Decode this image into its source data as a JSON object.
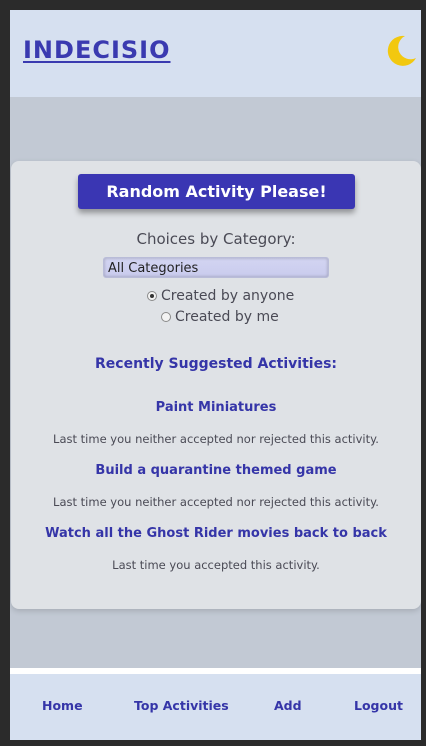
{
  "header": {
    "logo": "INDECISIO",
    "theme_toggle_icon": "moon-icon",
    "moon_color": "#f2c80f"
  },
  "main": {
    "random_button_label": "Random Activity Please!",
    "choices_label": "Choices by Category:",
    "category_selected": "All Categories",
    "filter_options": [
      {
        "label": "Created by anyone",
        "checked": true
      },
      {
        "label": "Created by me",
        "checked": false
      }
    ],
    "recent_heading": "Recently Suggested Activities:",
    "activities": [
      {
        "title": "Paint Miniatures",
        "status": "Last time you neither accepted nor rejected this activity."
      },
      {
        "title": "Build a quarantine themed game",
        "status": "Last time you neither accepted nor rejected this activity."
      },
      {
        "title": "Watch all the Ghost Rider movies back to back",
        "status": "Last time you accepted this activity."
      }
    ]
  },
  "footer": {
    "nav": [
      "Home",
      "Top Activities",
      "Add",
      "Logout"
    ]
  },
  "colors": {
    "accent": "#3a36b3",
    "header_bg": "#d6e0f0",
    "page_bg": "#c2c9d4",
    "card_bg": "#dfe2e6"
  }
}
